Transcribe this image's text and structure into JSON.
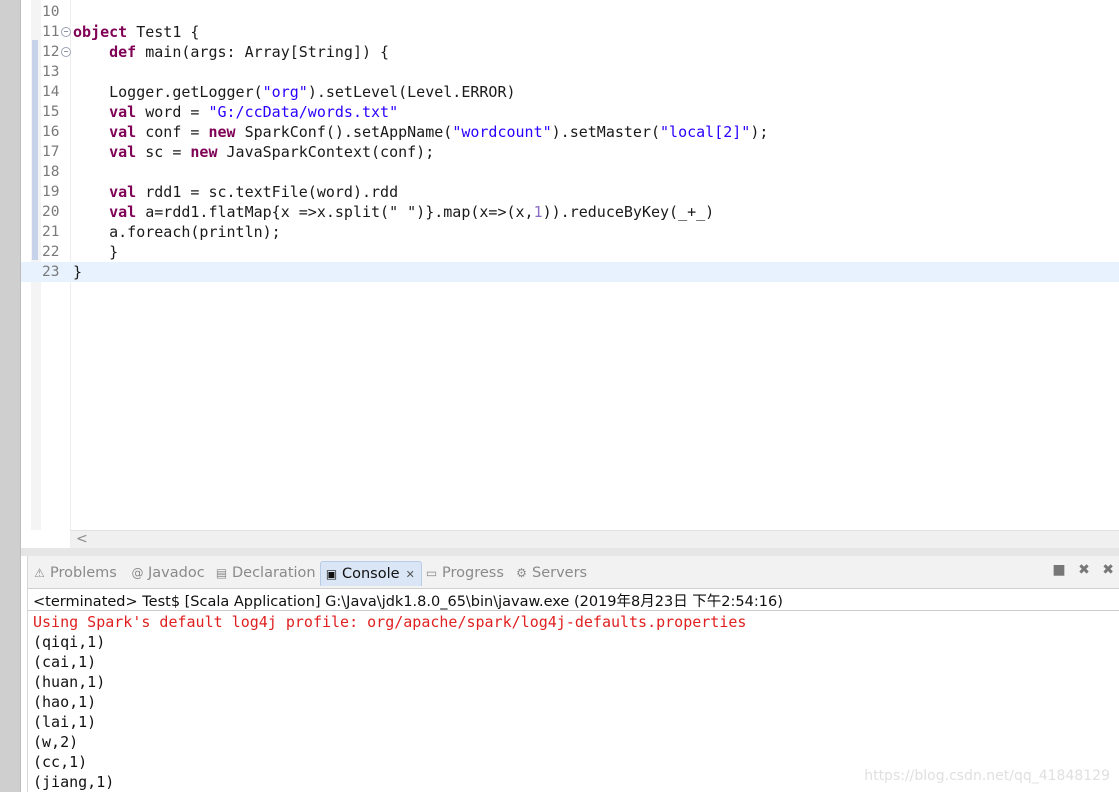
{
  "editor": {
    "lines": [
      {
        "no": "10",
        "segments": []
      },
      {
        "no": "11",
        "fold": "⊖",
        "segments": [
          {
            "c": "kw",
            "t": "object"
          },
          {
            "c": "",
            "t": " Test1 "
          },
          {
            "c": "",
            "t": "{"
          }
        ]
      },
      {
        "no": "12",
        "fold": "⊖",
        "segments": [
          {
            "c": "",
            "t": "    "
          },
          {
            "c": "kw",
            "t": "def"
          },
          {
            "c": "",
            "t": " main(args: Array[String]) {"
          }
        ]
      },
      {
        "no": "13",
        "segments": []
      },
      {
        "no": "14",
        "segments": [
          {
            "c": "",
            "t": "    Logger.getLogger("
          },
          {
            "c": "str",
            "t": "\"org\""
          },
          {
            "c": "",
            "t": ").setLevel(Level.ERROR)"
          }
        ]
      },
      {
        "no": "15",
        "segments": [
          {
            "c": "",
            "t": "    "
          },
          {
            "c": "kw",
            "t": "val"
          },
          {
            "c": "",
            "t": " word = "
          },
          {
            "c": "str",
            "t": "\"G:/ccData/words.txt\""
          }
        ]
      },
      {
        "no": "16",
        "segments": [
          {
            "c": "",
            "t": "    "
          },
          {
            "c": "kw",
            "t": "val"
          },
          {
            "c": "",
            "t": " conf = "
          },
          {
            "c": "kw",
            "t": "new"
          },
          {
            "c": "",
            "t": " SparkConf().setAppName("
          },
          {
            "c": "str",
            "t": "\"wordcount\""
          },
          {
            "c": "",
            "t": ").setMaster("
          },
          {
            "c": "str",
            "t": "\"local[2]\""
          },
          {
            "c": "",
            "t": ");"
          }
        ]
      },
      {
        "no": "17",
        "segments": [
          {
            "c": "",
            "t": "    "
          },
          {
            "c": "kw",
            "t": "val"
          },
          {
            "c": "",
            "t": " sc = "
          },
          {
            "c": "kw",
            "t": "new"
          },
          {
            "c": "",
            "t": " JavaSparkContext(conf);"
          }
        ]
      },
      {
        "no": "18",
        "segments": []
      },
      {
        "no": "19",
        "segments": [
          {
            "c": "",
            "t": "    "
          },
          {
            "c": "kw",
            "t": "val"
          },
          {
            "c": "",
            "t": " rdd1 = sc.textFile(word).rdd"
          }
        ]
      },
      {
        "no": "20",
        "segments": [
          {
            "c": "",
            "t": "    "
          },
          {
            "c": "kw",
            "t": "val"
          },
          {
            "c": "",
            "t": " a=rdd1.flatMap{x =>x.split(\" \")}.map(x=>(x,"
          },
          {
            "c": "num",
            "t": "1"
          },
          {
            "c": "",
            "t": ")).reduceByKey(_+_)"
          }
        ]
      },
      {
        "no": "21",
        "segments": [
          {
            "c": "",
            "t": "    a.foreach(println);"
          }
        ]
      },
      {
        "no": "22",
        "segments": [
          {
            "c": "",
            "t": "    }"
          }
        ]
      },
      {
        "no": "23",
        "segments": [
          {
            "c": "",
            "t": "}"
          }
        ]
      }
    ],
    "scroll_left_arrow": "<"
  },
  "panel": {
    "tabs": [
      {
        "label": "Problems",
        "icon": "problems-icon",
        "glyph": "⚠"
      },
      {
        "label": "Javadoc",
        "icon": "javadoc-icon",
        "glyph": "@"
      },
      {
        "label": "Declaration",
        "icon": "declaration-icon",
        "glyph": "▤"
      },
      {
        "label": "Console",
        "icon": "console-icon",
        "glyph": "▣",
        "active": true,
        "close": "✕"
      },
      {
        "label": "Progress",
        "icon": "progress-icon",
        "glyph": "▭"
      },
      {
        "label": "Servers",
        "icon": "servers-icon",
        "glyph": "⚙"
      }
    ],
    "tools": {
      "stop": "■",
      "remove": "✖",
      "remove_all": "✖"
    },
    "status": "<terminated> Test$ [Scala Application] G:\\Java\\jdk1.8.0_65\\bin\\javaw.exe (2019年8月23日 下午2:54:16)",
    "output": [
      {
        "text": "Using Spark's default log4j profile: org/apache/spark/log4j-defaults.properties",
        "err": true
      },
      {
        "text": "(qiqi,1)"
      },
      {
        "text": "(cai,1)"
      },
      {
        "text": "(huan,1)"
      },
      {
        "text": "(hao,1)"
      },
      {
        "text": "(lai,1)"
      },
      {
        "text": "(w,2)"
      },
      {
        "text": "(cc,1)"
      },
      {
        "text": "(jiang,1)"
      }
    ]
  },
  "watermark": "https://blog.csdn.net/qq_41848129",
  "colors": {
    "keyword": "#7f0055",
    "string": "#2a00ff",
    "error": "#e02020",
    "current_line": "#e8f2fe"
  }
}
